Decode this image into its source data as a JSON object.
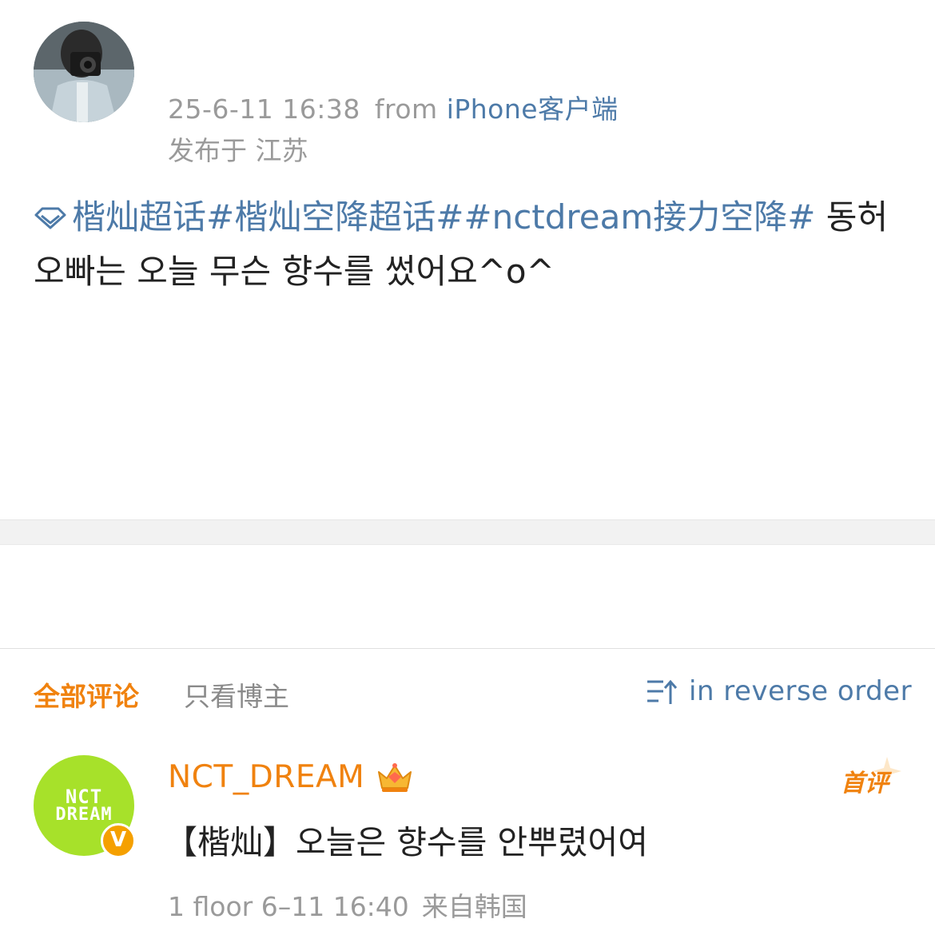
{
  "post": {
    "timestamp": "25-6-11 16:38",
    "from_label": "from",
    "client": "iPhone客户端",
    "location": "发布于 江苏",
    "body": {
      "hashtags": "楷灿超话#楷灿空降超话##nctdream接力空降#",
      "text": " 동허오빠는 오늘 무슨 향수를 썼어요^o^"
    },
    "supertopic_icon": "diamond-icon"
  },
  "comments_header": {
    "tab_all": "全部评论",
    "tab_blogger_only": "只看博主",
    "sort_label": "in reverse order",
    "sort_icon": "sort-reverse-icon"
  },
  "comments": [
    {
      "username": "NCT_DREAM",
      "avatar_logo_line1": "NCT",
      "avatar_logo_line2": "DREAM",
      "verified_mark": "V",
      "badge_icon": "crown-icon",
      "first_comment_badge": "首评",
      "text": "【楷灿】오늘은 향수를 안뿌렸어여",
      "floor": "1 floor",
      "time": "6–11 16:40",
      "location": "来自韩国"
    }
  ],
  "colors": {
    "link_blue": "#4d7aa8",
    "accent_orange": "#f0820f",
    "meta_gray": "#9a9a9a",
    "avatar_green": "#a7e12a"
  }
}
